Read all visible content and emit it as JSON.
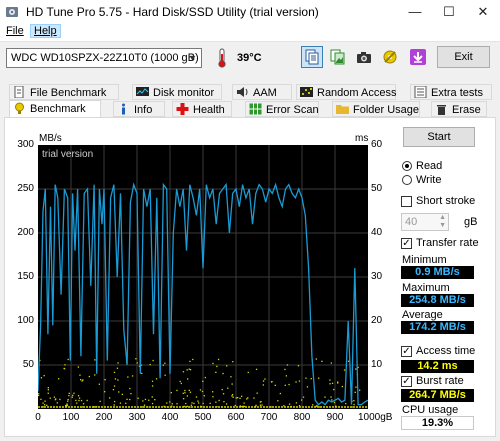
{
  "window": {
    "title": "HD Tune Pro 5.75 - Hard Disk/SSD Utility (trial version)",
    "minimize": "—",
    "maximize": "☐",
    "close": "✕"
  },
  "menu": [
    "File",
    "Help"
  ],
  "toolbar": {
    "drive": "WDC WD10SPZX-22Z10T0 (1000 gB)",
    "temperature": "39°C",
    "exit_label": "Exit"
  },
  "tabs_row1": [
    "File Benchmark",
    "Disk monitor",
    "AAM",
    "Random Access",
    "Extra tests"
  ],
  "tabs_row2": [
    "Benchmark",
    "Info",
    "Health",
    "Error Scan",
    "Folder Usage",
    "Erase"
  ],
  "chart_data": {
    "type": "line",
    "watermark": "trial version",
    "left_axis": {
      "label": "MB/s",
      "ticks": [
        300,
        250,
        200,
        150,
        100,
        50
      ],
      "ylim": [
        0,
        300
      ]
    },
    "right_axis": {
      "label": "ms",
      "ticks": [
        60,
        50,
        40,
        30,
        20,
        10
      ],
      "ylim": [
        0,
        60
      ]
    },
    "x_axis": {
      "ticks": [
        "0",
        "100",
        "200",
        "300",
        "400",
        "500",
        "600",
        "700",
        "800",
        "900",
        "1000gB"
      ],
      "xlim": [
        0,
        1000
      ]
    },
    "series": [
      {
        "name": "Transfer rate",
        "color": "#1b9bd6",
        "x": [
          0,
          8,
          15,
          22,
          30,
          38,
          45,
          52,
          60,
          70,
          80,
          90,
          98,
          105,
          112,
          120,
          130,
          140,
          150,
          160,
          170,
          178,
          186,
          194,
          200,
          210,
          220,
          230,
          240,
          250,
          260,
          270,
          280,
          290,
          300,
          310,
          320,
          330,
          340,
          350,
          360,
          370,
          380,
          390,
          400,
          410,
          420,
          430,
          440,
          450,
          460,
          470,
          480,
          490,
          500,
          510,
          520,
          530,
          540,
          550,
          560,
          570,
          580,
          590,
          600,
          610,
          620,
          630,
          640,
          650,
          660,
          670,
          680,
          690,
          700,
          710,
          720,
          730,
          740,
          750,
          760,
          770,
          780,
          790,
          800,
          810,
          820,
          830,
          840,
          850,
          860,
          870,
          880,
          890,
          900,
          910,
          920,
          930,
          940,
          950,
          960,
          970,
          980,
          990,
          1000
        ],
        "y": [
          20,
          95,
          225,
          250,
          85,
          230,
          95,
          255,
          240,
          130,
          250,
          240,
          55,
          245,
          180,
          250,
          60,
          245,
          250,
          140,
          255,
          40,
          250,
          210,
          250,
          55,
          240,
          255,
          150,
          245,
          90,
          50,
          235,
          255,
          245,
          40,
          250,
          230,
          250,
          85,
          240,
          35,
          255,
          250,
          40,
          200,
          250,
          230,
          250,
          180,
          255,
          240,
          220,
          250,
          160,
          255,
          240,
          250,
          210,
          245,
          250,
          255,
          200,
          245,
          250,
          230,
          255,
          240,
          250,
          210,
          245,
          255,
          250,
          235,
          250,
          245,
          255,
          240,
          230,
          250,
          255,
          245,
          240,
          250,
          240,
          220,
          160,
          60,
          10,
          5,
          8,
          5,
          10,
          8,
          10,
          12,
          8,
          10,
          100,
          5,
          160,
          5,
          5,
          8,
          10
        ]
      },
      {
        "name": "Access time",
        "color": "#d8d800"
      },
      {
        "name": "Burst rate",
        "color": "#d8d800"
      }
    ]
  },
  "side": {
    "start_label": "Start",
    "read_label": "Read",
    "write_label": "Write",
    "short_stroke_label": "Short stroke",
    "stroke_value": "40",
    "stroke_unit": "gB",
    "transfer_rate_label": "Transfer rate",
    "minimum_label": "Minimum",
    "minimum_value": "0.9 MB/s",
    "maximum_label": "Maximum",
    "maximum_value": "254.8 MB/s",
    "average_label": "Average",
    "average_value": "174.2 MB/s",
    "access_time_label": "Access time",
    "access_time_value": "14.2 ms",
    "burst_rate_label": "Burst rate",
    "burst_rate_value": "264.7 MB/s",
    "cpu_usage_label": "CPU usage",
    "cpu_usage_value": "19.3%"
  }
}
